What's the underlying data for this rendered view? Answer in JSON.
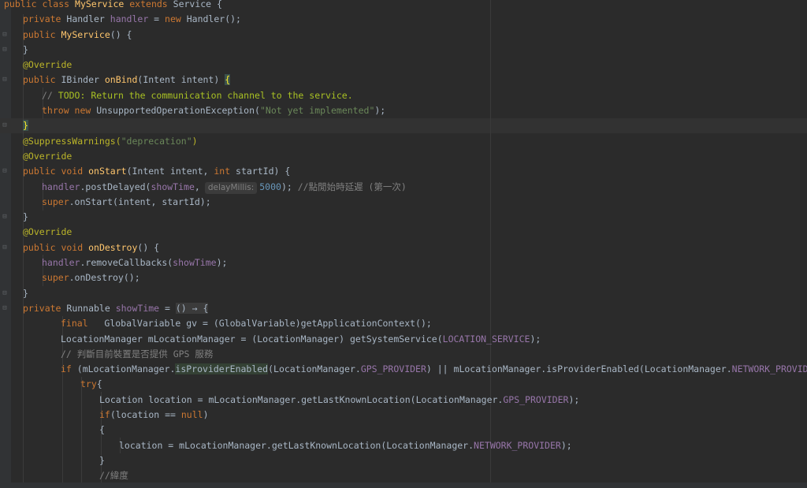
{
  "editor": {
    "lines": [
      {
        "indent": 0,
        "fold": "",
        "tokens": [
          [
            "kw",
            "public class "
          ],
          [
            "fn",
            "MyService"
          ],
          [
            "kw",
            " extends "
          ],
          [
            "",
            "Service {"
          ]
        ]
      },
      {
        "indent": 1,
        "fold": "",
        "tokens": [
          [
            "kw",
            "private "
          ],
          [
            "",
            "Handler "
          ],
          [
            "fld",
            "handler"
          ],
          [
            "",
            " = "
          ],
          [
            "kw",
            "new "
          ],
          [
            "",
            "Handler();"
          ]
        ]
      },
      {
        "indent": 1,
        "fold": "⊟",
        "tokens": [
          [
            "kw",
            "public "
          ],
          [
            "fn",
            "MyService"
          ],
          [
            "",
            "() {"
          ]
        ]
      },
      {
        "indent": 1,
        "fold": "⊟",
        "tokens": [
          [
            "",
            "}"
          ]
        ]
      },
      {
        "indent": 1,
        "fold": "",
        "tokens": [
          [
            "ann",
            "@Override"
          ]
        ]
      },
      {
        "indent": 1,
        "fold": "⊟",
        "tokens": [
          [
            "kw",
            "public "
          ],
          [
            "",
            "IBinder "
          ],
          [
            "fn",
            "onBind"
          ],
          [
            "",
            "(Intent intent) "
          ],
          [
            "brace-match",
            "{"
          ]
        ]
      },
      {
        "indent": 2,
        "fold": "",
        "tokens": [
          [
            "cm",
            "// "
          ],
          [
            "todo",
            "TODO: Return the communication channel to the service."
          ]
        ]
      },
      {
        "indent": 2,
        "fold": "",
        "tokens": [
          [
            "kw",
            "throw new "
          ],
          [
            "",
            "UnsupportedOperationException("
          ],
          [
            "str",
            "\"Not yet implemented\""
          ],
          [
            "",
            ");"
          ]
        ]
      },
      {
        "indent": 1,
        "fold": "⊟",
        "tokens": [
          [
            "brace-match",
            "}"
          ]
        ]
      },
      {
        "indent": 1,
        "fold": "",
        "tokens": [
          [
            "ann",
            "@SuppressWarnings("
          ],
          [
            "str",
            "\"deprecation\""
          ],
          [
            "ann",
            ")"
          ]
        ]
      },
      {
        "indent": 1,
        "fold": "",
        "tokens": [
          [
            "ann",
            "@Override"
          ]
        ]
      },
      {
        "indent": 1,
        "fold": "⊟",
        "tokens": [
          [
            "kw",
            "public void "
          ],
          [
            "fn",
            "onStart"
          ],
          [
            "",
            "(Intent intent, "
          ],
          [
            "kw",
            "int "
          ],
          [
            "",
            "startId) {"
          ]
        ]
      },
      {
        "indent": 2,
        "fold": "",
        "tokens": [
          [
            "fld",
            "handler"
          ],
          [
            "",
            ".postDelayed("
          ],
          [
            "fld",
            "showTime"
          ],
          [
            "",
            ","
          ],
          [
            "hint",
            "delayMillis:"
          ],
          [
            "num",
            "5000"
          ],
          [
            "",
            "); "
          ],
          [
            "cm",
            "//點閒始時延遲 (第一次)"
          ]
        ]
      },
      {
        "indent": 2,
        "fold": "",
        "tokens": [
          [
            "kw",
            "super"
          ],
          [
            "",
            ".onStart(intent, startId);"
          ]
        ]
      },
      {
        "indent": 1,
        "fold": "⊟",
        "tokens": [
          [
            "",
            "}"
          ]
        ]
      },
      {
        "indent": 1,
        "fold": "",
        "tokens": [
          [
            "ann",
            "@Override"
          ]
        ]
      },
      {
        "indent": 1,
        "fold": "⊟",
        "tokens": [
          [
            "kw",
            "public void "
          ],
          [
            "fn",
            "onDestroy"
          ],
          [
            "",
            "() {"
          ]
        ]
      },
      {
        "indent": 2,
        "fold": "",
        "tokens": [
          [
            "fld",
            "handler"
          ],
          [
            "",
            ".removeCallbacks("
          ],
          [
            "fld",
            "showTime"
          ],
          [
            "",
            ");"
          ]
        ]
      },
      {
        "indent": 2,
        "fold": "",
        "tokens": [
          [
            "kw",
            "super"
          ],
          [
            "",
            ".onDestroy();"
          ]
        ]
      },
      {
        "indent": 1,
        "fold": "⊟",
        "tokens": [
          [
            "",
            "}"
          ]
        ]
      },
      {
        "indent": 1,
        "fold": "⊟",
        "tokens": [
          [
            "kw",
            "private "
          ],
          [
            "",
            "Runnable "
          ],
          [
            "fld",
            "showTime"
          ],
          [
            "",
            " = "
          ],
          [
            "lambda-bg",
            "() → {"
          ]
        ]
      },
      {
        "indent": 3,
        "fold": "",
        "tokens": [
          [
            "kw",
            "final   "
          ],
          [
            "",
            "GlobalVariable gv = (GlobalVariable)getApplicationContext();"
          ]
        ]
      },
      {
        "indent": 3,
        "fold": "",
        "tokens": [
          [
            "",
            "LocationManager mLocationManager = (LocationManager) getSystemService("
          ],
          [
            "fld",
            "LOCATION_SERVICE"
          ],
          [
            "",
            ");"
          ]
        ]
      },
      {
        "indent": 3,
        "fold": "",
        "tokens": [
          [
            "cm",
            "// 判斷目前裝置是否提供 GPS 服務"
          ]
        ]
      },
      {
        "indent": 3,
        "fold": "",
        "tokens": [
          [
            "kw",
            "if "
          ],
          [
            "",
            "(mLocationManager."
          ],
          [
            "usage-hl",
            "isProviderEnabled"
          ],
          [
            "",
            "(LocationManager."
          ],
          [
            "fld",
            "GPS_PROVIDER"
          ],
          [
            "",
            ") || mLocationManager.isProviderEnabled(LocationManager."
          ],
          [
            "fld",
            "NETWORK_PROVIDER"
          ],
          [
            "",
            ")) {"
          ]
        ]
      },
      {
        "indent": 4,
        "fold": "",
        "tokens": [
          [
            "kw",
            "try"
          ],
          [
            "",
            "{"
          ]
        ]
      },
      {
        "indent": 5,
        "fold": "",
        "tokens": [
          [
            "",
            "Location location = mLocationManager.getLastKnownLocation(LocationManager."
          ],
          [
            "fld",
            "GPS_PROVIDER"
          ],
          [
            "",
            ");"
          ]
        ]
      },
      {
        "indent": 5,
        "fold": "",
        "tokens": [
          [
            "kw",
            "if"
          ],
          [
            "",
            "(location == "
          ],
          [
            "kw",
            "null"
          ],
          [
            "",
            ")"
          ]
        ]
      },
      {
        "indent": 5,
        "fold": "",
        "tokens": [
          [
            "",
            "{"
          ]
        ]
      },
      {
        "indent": 6,
        "fold": "",
        "tokens": [
          [
            "",
            "location = mLocationManager.getLastKnownLocation(LocationManager."
          ],
          [
            "fld",
            "NETWORK_PROVIDER"
          ],
          [
            "",
            ");"
          ]
        ]
      },
      {
        "indent": 5,
        "fold": "",
        "tokens": [
          [
            "",
            "}"
          ]
        ]
      },
      {
        "indent": 5,
        "fold": "",
        "tokens": [
          [
            "cm",
            "//緯度"
          ]
        ]
      }
    ]
  },
  "colors": {
    "background": "#2b2b2b",
    "keyword": "#cc7832",
    "method": "#ffc66d",
    "field": "#9876aa",
    "annotation": "#bbb529",
    "string": "#6a8759",
    "comment": "#808080",
    "number": "#6897bb"
  }
}
